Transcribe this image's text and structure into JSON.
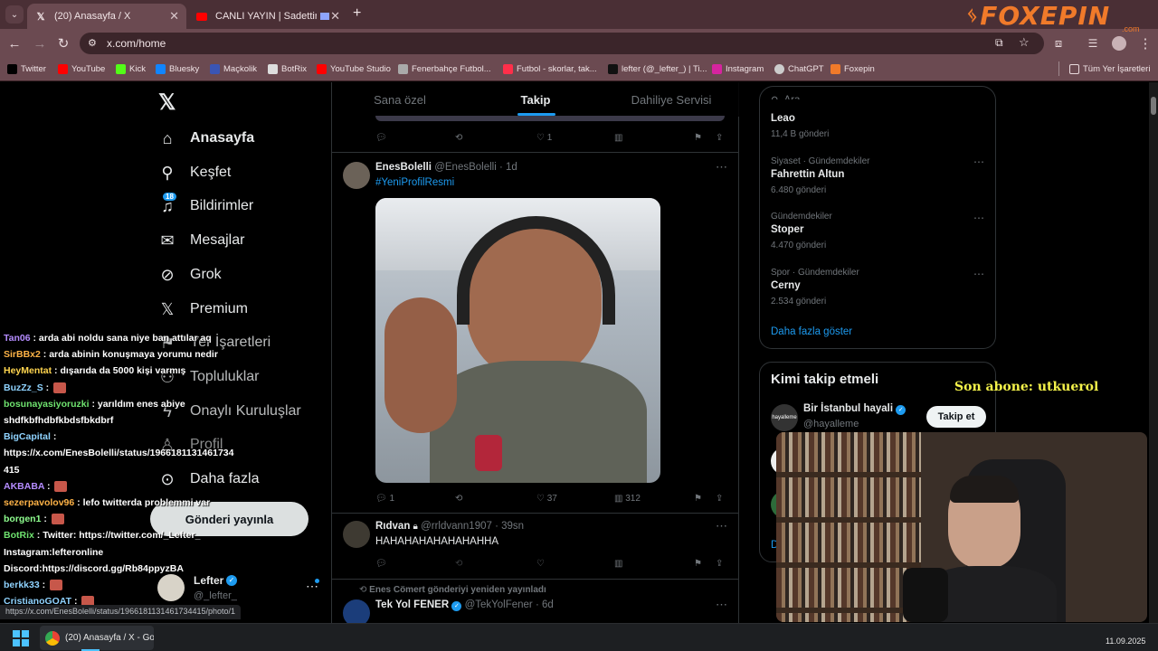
{
  "browser": {
    "tabs": [
      {
        "title": "(20) Anasayfa / X",
        "active": true
      },
      {
        "title": "CANLI YAYIN | Sadettin Sar...",
        "active": false
      }
    ],
    "url": "x.com/home",
    "bookmarks": [
      "Twitter",
      "YouTube",
      "Kick",
      "Bluesky",
      "Maçkolik",
      "BotRix",
      "YouTube Studio",
      "Fenerbahçe Futbol...",
      "Futbol - skorlar, tak...",
      "lefter (@_lefter_) | Ti...",
      "Instagram",
      "ChatGPT",
      "Foxepin"
    ],
    "all_bookmarks": "Tüm Yer İşaretleri",
    "status_url": "https://x.com/EnesBolelli/status/1966181131461734415/photo/1"
  },
  "watermark": {
    "brand": "FOXEPIN",
    "sub": ".com"
  },
  "sidebar": {
    "items": [
      {
        "label": "Anasayfa",
        "icon": "home-icon"
      },
      {
        "label": "Keşfet",
        "icon": "search-icon"
      },
      {
        "label": "Bildirimler",
        "icon": "bell-icon",
        "badge": "18"
      },
      {
        "label": "Mesajlar",
        "icon": "mail-icon"
      },
      {
        "label": "Grok",
        "icon": "grok-icon"
      },
      {
        "label": "Premium",
        "icon": "x-logo-icon"
      },
      {
        "label": "Yer İşaretleri",
        "icon": "bookmark-icon"
      },
      {
        "label": "Topluluklar",
        "icon": "people-icon"
      },
      {
        "label": "Onaylı Kuruluşlar",
        "icon": "lightning-icon"
      },
      {
        "label": "Profil",
        "icon": "person-icon"
      },
      {
        "label": "Daha fazla",
        "icon": "more-circle-icon"
      }
    ],
    "post_button": "Gönderi yayınla",
    "account": {
      "name": "Lefter",
      "handle": "@_lefter_"
    }
  },
  "timeline": {
    "tabs": [
      "Sana özel",
      "Takip",
      "Dahiliye Servisi"
    ],
    "first_actions": {
      "replies": "",
      "likes": "1"
    },
    "tweets": [
      {
        "name": "EnesBolelli",
        "handle": "@EnesBolelli",
        "time": "1d",
        "text": "#YeniProfilResmi",
        "replies": "1",
        "reposts": "",
        "likes": "37",
        "views": "312"
      },
      {
        "name": "Rıdvan",
        "handle": "@rrldvann1907",
        "time": "39sn",
        "text": "HAHAHAHAHAHAHAHHA"
      },
      {
        "repost_by": "Enes Cömert gönderiyi yeniden yayınladı",
        "name": "Tek Yol FENER",
        "handle": "@TekYolFener",
        "time": "6d"
      }
    ]
  },
  "right": {
    "search_placeholder": "Ara",
    "trends": [
      {
        "name": "Leao",
        "count": "11,4 B gönderi",
        "category": ""
      },
      {
        "category": "Siyaset · Gündemdekiler",
        "name": "Fahrettin Altun",
        "count": "6.480 gönderi"
      },
      {
        "category": "Gündemdekiler",
        "name": "Stoper",
        "count": "4.470 gönderi"
      },
      {
        "category": "Spor · Gündemdekiler",
        "name": "Cerny",
        "count": "2.534 gönderi"
      }
    ],
    "show_more": "Daha fazla göster",
    "who_to_follow": {
      "title": "Kimi takip etmeli",
      "accounts": [
        {
          "name": "Bir İstanbul hayali",
          "handle": "@hayalleme",
          "button": "Takip et"
        }
      ]
    }
  },
  "stream_overlay": {
    "last_sub": "Son abone: utkuerol",
    "chat": [
      {
        "user": "Tan06",
        "msg": "arda abi noldu sana niye ban attılar aq",
        "color": "#b58cff"
      },
      {
        "user": "SirBBx2",
        "msg": "arda abinin konuşmaya yorumu nedir",
        "color": "#ffb347"
      },
      {
        "user": "HeyMentat",
        "msg": "dışarıda da 5000 kişi varmış",
        "color": "#ffd54f"
      },
      {
        "user": "BuzZz_S",
        "msg": "",
        "color": "#8fd3ff"
      },
      {
        "user": "bosunayasiyoruzki",
        "msg": "yarıldım enes abiye",
        "color": "#6fe36f"
      },
      {
        "user": "",
        "msg": "shdfkbfhdbfkbdsfbkdbrf",
        "color": "#fff"
      },
      {
        "user": "BigCapital",
        "msg": "",
        "color": "#8fd3ff"
      },
      {
        "user": "",
        "msg": "https://x.com/EnesBolelli/status/1966181131461734",
        "color": "#fff"
      },
      {
        "user": "",
        "msg": "415",
        "color": "#fff"
      },
      {
        "user": "AKBABA",
        "msg": "",
        "color": "#b58cff"
      },
      {
        "user": "sezerpavolov96",
        "msg": "lefo twitterda problemmi var",
        "color": "#ffb347"
      },
      {
        "user": "borgen1",
        "msg": "",
        "color": "#8fff8f"
      },
      {
        "user": "BotRix",
        "msg": "Twitter: https://twitter.com/_Lefter_",
        "color": "#6fe36f"
      },
      {
        "user": "",
        "msg": "Instagram:lefteronline",
        "color": "#fff"
      },
      {
        "user": "",
        "msg": "Discord:https://discord.gg/Rb84ppyzBA",
        "color": "#fff"
      },
      {
        "user": "berkk33",
        "msg": "",
        "color": "#8fd3ff"
      },
      {
        "user": "CristianoGOAT",
        "msg": "",
        "color": "#8fd3ff"
      }
    ]
  },
  "taskbar": {
    "window": "(20) Anasayfa / X - Goo",
    "date": "11.09.2025"
  },
  "colors": {
    "accent": "#1d9bf0",
    "chrome_tab": "#4a2f35",
    "chrome_bar": "#6b4a51",
    "foxepin": "#f07a2a",
    "sub_yellow": "#f4f24a"
  }
}
